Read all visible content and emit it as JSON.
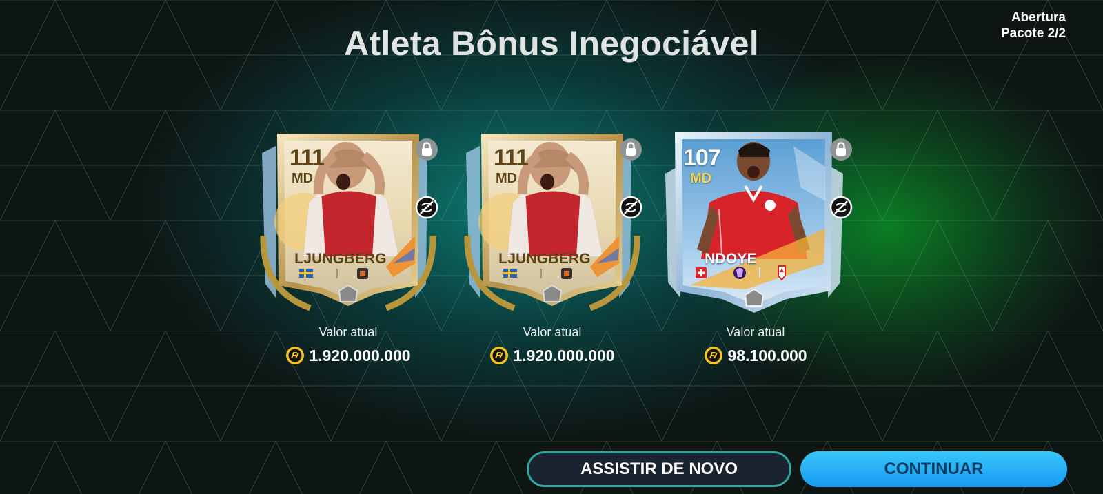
{
  "header": {
    "title": "Atleta Bônus Inegociável",
    "pack_line1": "Abertura",
    "pack_line2": "Pacote 2/2"
  },
  "cards": [
    {
      "rating": "111",
      "position": "MD",
      "name": "LJUNGBERG",
      "value_label": "Valor atual",
      "value": "1.920.000.000",
      "style": "gold",
      "nation": "sweden-flag-icon",
      "club": "club-badge-icon"
    },
    {
      "rating": "111",
      "position": "MD",
      "name": "LJUNGBERG",
      "value_label": "Valor atual",
      "value": "1.920.000.000",
      "style": "gold",
      "nation": "sweden-flag-icon",
      "club": "club-badge-icon"
    },
    {
      "rating": "107",
      "position": "MD",
      "name": "NDOYE",
      "value_label": "Valor atual",
      "value": "98.100.000",
      "style": "blue",
      "nation": "switzerland-flag-icon",
      "league": "premier-league-icon",
      "club": "nottingham-forest-icon"
    }
  ],
  "buttons": {
    "replay": "ASSISTIR DE NOVO",
    "continue": "CONTINUAR"
  },
  "colors": {
    "accent_blue": "#1ea8f5",
    "teal_border": "#2fa6a0",
    "gold_text": "#5b4418"
  }
}
